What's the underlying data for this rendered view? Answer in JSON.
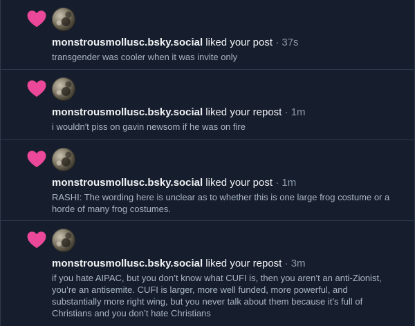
{
  "colors": {
    "background": "#161e2d",
    "divider": "#2e3c4f",
    "heart": "#ec4899",
    "text_primary": "#f1f3f5",
    "text_secondary": "#aab6c4",
    "text_muted": "#8c9aab"
  },
  "notifications": [
    {
      "icon": "heart-icon",
      "handle": "monstrousmollusc.bsky.social",
      "action": "liked your post",
      "time": "· 37s",
      "text": "transgender was cooler when it was invite only"
    },
    {
      "icon": "heart-icon",
      "handle": "monstrousmollusc.bsky.social",
      "action": "liked your repost",
      "time": "· 1m",
      "text": "i wouldn't piss on gavin newsom if he was on fire"
    },
    {
      "icon": "heart-icon",
      "handle": "monstrousmollusc.bsky.social",
      "action": "liked your post",
      "time": "· 1m",
      "text": "RASHI: The wording here is unclear as to whether this is one large frog costume or a horde of many frog costumes."
    },
    {
      "icon": "heart-icon",
      "handle": "monstrousmollusc.bsky.social",
      "action": "liked your repost",
      "time": "· 3m",
      "text": "if you hate AIPAC, but you don’t know what CUFI is, then you aren’t an anti-Zionist, you’re an antisemite. CUFI is larger, more well funded, more powerful, and substantially more right wing, but you never talk about them because it’s full of Christians and you don’t hate Christians"
    }
  ]
}
